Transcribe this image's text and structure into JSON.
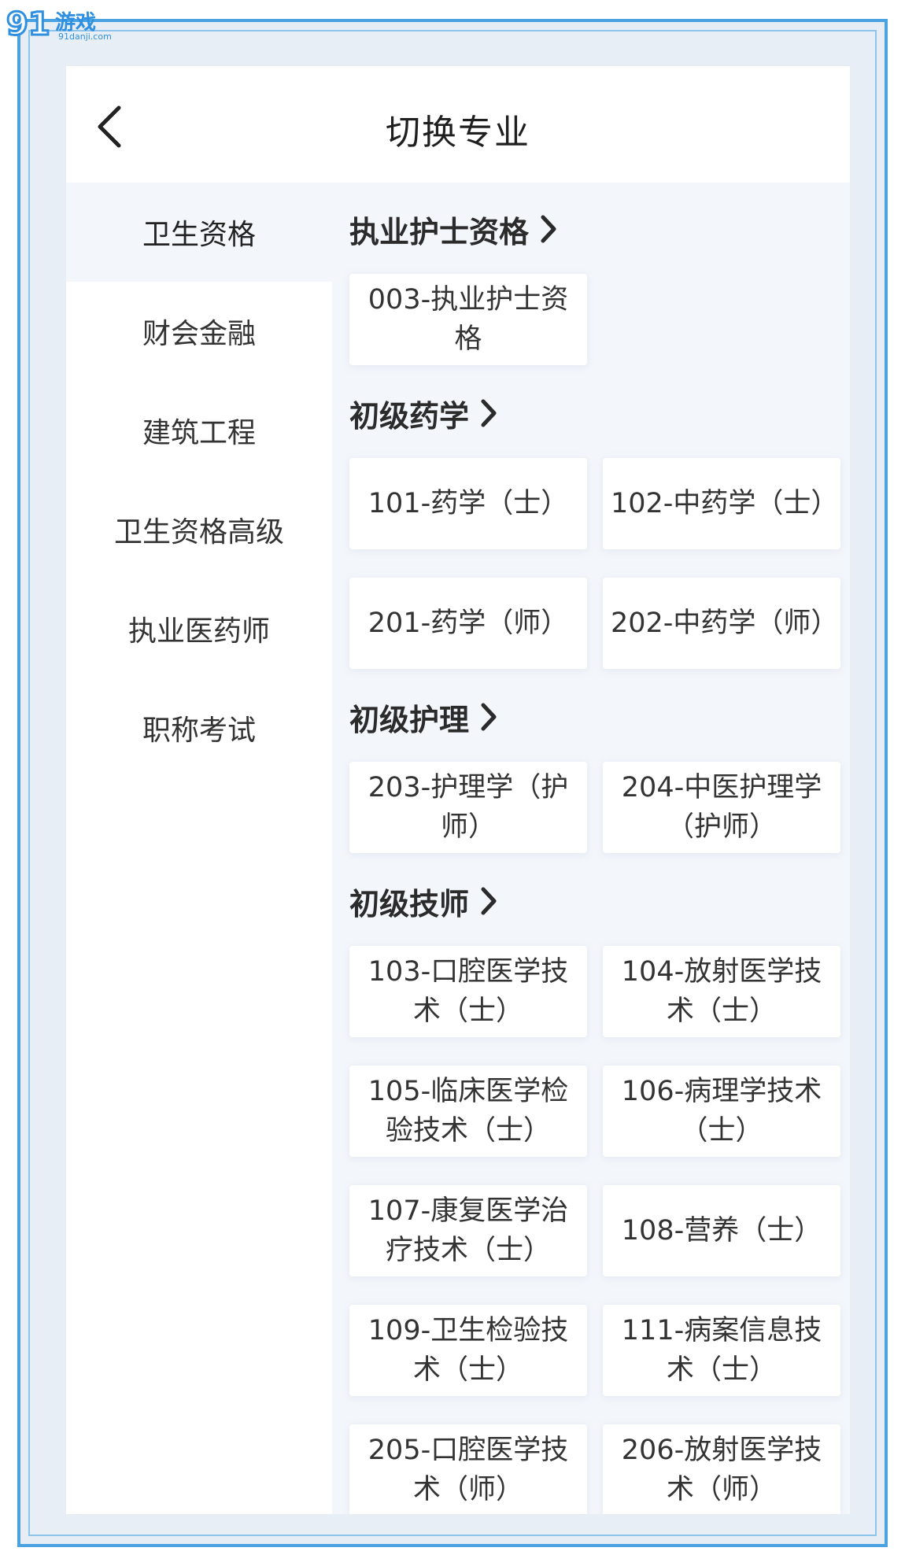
{
  "watermark": {
    "brand": "游戏",
    "site": "91danji.com",
    "logo_digits": "91"
  },
  "header": {
    "title": "切换专业"
  },
  "sidebar": {
    "items": [
      {
        "label": "卫生资格",
        "active": true
      },
      {
        "label": "财会金融"
      },
      {
        "label": "建筑工程"
      },
      {
        "label": "卫生资格高级"
      },
      {
        "label": "执业医药师"
      },
      {
        "label": "职称考试"
      }
    ]
  },
  "sections": [
    {
      "title": "执业护士资格",
      "items": [
        "003-执业护士资格"
      ]
    },
    {
      "title": "初级药学",
      "items": [
        "101-药学（士）",
        "102-中药学（士）",
        "201-药学（师）",
        "202-中药学（师）"
      ]
    },
    {
      "title": "初级护理",
      "items": [
        "203-护理学（护师）",
        "204-中医护理学（护师）"
      ]
    },
    {
      "title": "初级技师",
      "items": [
        "103-口腔医学技术（士）",
        "104-放射医学技术（士）",
        "105-临床医学检验技术（士）",
        "106-病理学技术（士）",
        "107-康复医学治疗技术（士）",
        "108-营养（士）",
        "109-卫生检验技术（士）",
        "111-病案信息技术（士）",
        "205-口腔医学技术（师）",
        "206-放射医学技术（师）"
      ]
    }
  ],
  "colors": {
    "accent": "#4aa3e0",
    "text": "#333333",
    "background": "#f3f6fb"
  }
}
